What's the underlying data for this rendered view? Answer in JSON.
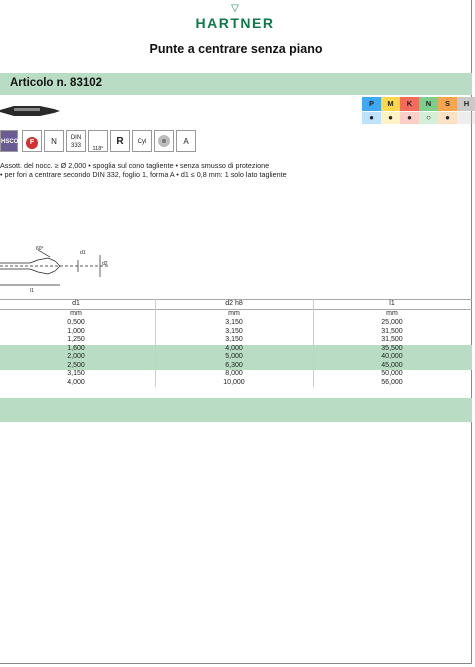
{
  "brand": {
    "name": "HARTNER",
    "mark": "▽"
  },
  "title": "Punte a centrare senza piano",
  "article": "Articolo n.  83102",
  "materials": [
    {
      "code": "P",
      "color": "#3fa9f5",
      "dot": "●"
    },
    {
      "code": "M",
      "color": "#ffd84a",
      "dot": "●"
    },
    {
      "code": "K",
      "color": "#f26b5b",
      "dot": "●"
    },
    {
      "code": "N",
      "color": "#7ccf8a",
      "dot": "○"
    },
    {
      "code": "S",
      "color": "#f7a64f",
      "dot": "●"
    },
    {
      "code": "H",
      "color": "#c9c9c9",
      "dot": ""
    }
  ],
  "symbols": [
    "HSCO",
    "F",
    "N",
    "DIN 333",
    "118°",
    "R",
    "Cyl",
    "",
    "A"
  ],
  "description": [
    "Assott. del nocc. ≥ Ø 2,000 • spoglia sul cono tagliente • senza smusso di protezione",
    "• per fori a centrare secondo DIN 332, foglio 1, forma A • d1 ≤ 0,8 mm: 1 solo lato tagliente"
  ],
  "drawing": {
    "labels": [
      "d1",
      "d2",
      "l1",
      "60°"
    ]
  },
  "table": {
    "headers": [
      "d1",
      "d2 h8",
      "l1"
    ],
    "units": [
      "mm",
      "mm",
      "mm"
    ],
    "rows": [
      [
        "0,500",
        "3,150",
        "25,000"
      ],
      [
        "1,000",
        "3,150",
        "31,500"
      ],
      [
        "1,250",
        "3,150",
        "31,500"
      ],
      [
        "1,600",
        "4,000",
        "35,500"
      ],
      [
        "2,000",
        "5,000",
        "40,000"
      ],
      [
        "2,500",
        "6,300",
        "45,000"
      ],
      [
        "3,150",
        "8,000",
        "50,000"
      ],
      [
        "4,000",
        "10,000",
        "56,000"
      ]
    ]
  }
}
